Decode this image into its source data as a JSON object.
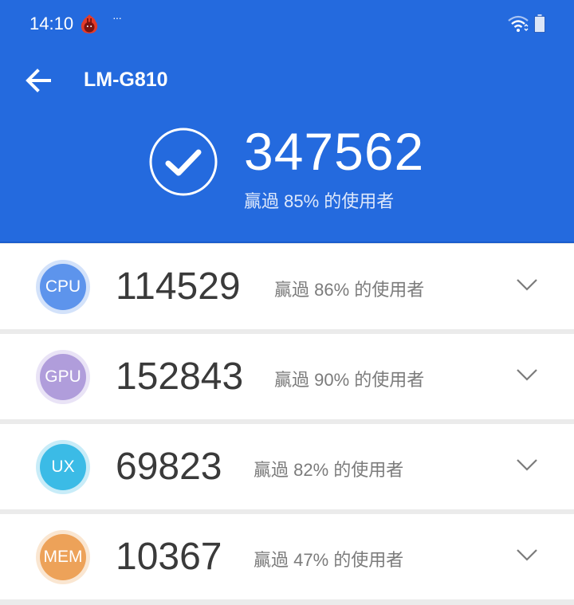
{
  "status_bar": {
    "time": "14:10",
    "notification_more": "···",
    "icons": [
      "antutu-app-icon",
      "wifi-icon",
      "battery-icon"
    ]
  },
  "toolbar": {
    "back_icon": "arrow-left-icon",
    "title": "LM-G810"
  },
  "summary": {
    "status_icon": "check-circle-icon",
    "total_score": "347562",
    "rank_text": "贏過 85% 的使用者"
  },
  "categories": [
    {
      "label": "CPU",
      "score": "114529",
      "rank_text": "贏過 86% 的使用者",
      "color": "#5d94ec",
      "ring": "#d3e2fa"
    },
    {
      "label": "GPU",
      "score": "152843",
      "rank_text": "贏過 90% 的使用者",
      "color": "#b09ddb",
      "ring": "#e9e3f6"
    },
    {
      "label": "UX",
      "score": "69823",
      "rank_text": "贏過 82% 的使用者",
      "color": "#3bbbe6",
      "ring": "#c8ecf8"
    },
    {
      "label": "MEM",
      "score": "10367",
      "rank_text": "贏過 47% 的使用者",
      "color": "#eda259",
      "ring": "#fae6d1"
    }
  ],
  "colors": {
    "header_bg": "#246ade",
    "page_bg": "#ebebeb"
  }
}
